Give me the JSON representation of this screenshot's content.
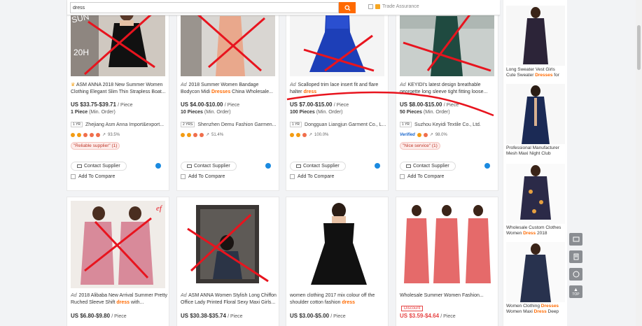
{
  "search": {
    "value": "dress",
    "button_icon": "search-icon",
    "trade_assurance": "Trade Assurance"
  },
  "products_row1": [
    {
      "ad": "",
      "crown": true,
      "title_pre": "ASM ANNA 2018 New Summer Women Clothing Elegant Slim Thin Strapless Boat...",
      "title_kw": "",
      "title_post": "",
      "price": "US $33.75-$39.71",
      "unit": "/ Piece",
      "moq_qty": "1 Piece",
      "moq_label": "(Min. Order)",
      "yrs": "1 YR",
      "supplier": "Zhejiang Asm Anna Import&export...",
      "rate": "93.5%",
      "tag": "\"Reliable supplier\" (1)",
      "contact": "Contact Supplier",
      "compare": "Add To Compare"
    },
    {
      "ad": "Ad",
      "crown": false,
      "title_pre": "2018 Summer Women Bandage Bodycon Midi ",
      "title_kw": "Dresses",
      "title_post": " China Wholesale...",
      "price": "US $4.00-$10.00",
      "unit": "/ Piece",
      "moq_qty": "10 Pieces",
      "moq_label": "(Min. Order)",
      "yrs": "2 YRS",
      "supplier": "Shenzhen Demu Fashion Garmen...",
      "rate": "51.4%",
      "tag": "",
      "contact": "Contact Supplier",
      "compare": "Add To Compare"
    },
    {
      "ad": "Ad",
      "crown": false,
      "title_pre": "Scalloped trim lace insert fit and flare halter ",
      "title_kw": "dress",
      "title_post": "",
      "price": "US $7.00-$15.00",
      "unit": "/ Piece",
      "moq_qty": "100 Pieces",
      "moq_label": "(Min. Order)",
      "yrs": "1 YR",
      "supplier": "Dongguan Liangjun Garment Co., L...",
      "rate": "100.0%",
      "tag": "",
      "contact": "Contact Supplier",
      "compare": "Add To Compare"
    },
    {
      "ad": "Ad",
      "crown": false,
      "title_pre": "KEYIDI's latest design breathable georgette long sleeve tight fitting loose...",
      "title_kw": "",
      "title_post": "",
      "price": "US $8.00-$15.00",
      "unit": "/ Piece",
      "moq_qty": "50 Pieces",
      "moq_label": "(Min. Order)",
      "yrs": "1 YR",
      "supplier": "Suzhou Keyidi Textile Co., Ltd.",
      "rate": "98.0%",
      "verified": "Verified",
      "tag": "\"Nice service\" (1)",
      "contact": "Contact Supplier",
      "compare": "Add To Compare"
    }
  ],
  "products_row2": [
    {
      "ad": "Ad",
      "title_pre": "2018 Alibaba New Arrival Summer Pretty Ruched Sleeve Shift ",
      "title_kw": "dress",
      "title_post": " with...",
      "price": "US $6.80-$9.80",
      "unit": "/ Piece",
      "red": false,
      "discount": ""
    },
    {
      "ad": "Ad",
      "title_pre": "ASM ANNA Women Stylish Long Chiffon Office Lady Printed Floral Sexy Maxi Girls...",
      "title_kw": "",
      "title_post": "",
      "price": "US $30.38-$35.74",
      "unit": "/ Piece",
      "red": false,
      "discount": ""
    },
    {
      "ad": "",
      "title_pre": "women clothing 2017 mix colour off the shoulder cotton fashion ",
      "title_kw": "dress",
      "title_post": "",
      "price": "US $3.00-$5.00",
      "unit": "/ Piece",
      "red": false,
      "discount": ""
    },
    {
      "ad": "",
      "title_pre": "Wholesale Summer Women Fashion...",
      "title_kw": "",
      "title_post": "",
      "price": "US $3.59-$4.64",
      "unit": "/ Piece",
      "red": true,
      "discount": "Discount"
    }
  ],
  "sidebar": [
    {
      "pre": "Long Sweater Vest Girls Cute Sweater ",
      "kw": "Dresses",
      "post": " for"
    },
    {
      "pre": "Professional Manufacturer Mesh Maxi Night Club",
      "kw": "",
      "post": ""
    },
    {
      "pre": "Wholesale Custom Clothes Women ",
      "kw": "Dress",
      "post": " 2018"
    },
    {
      "pre": "Women Clothing ",
      "kw": "Dresses",
      "post": "",
      "pre2": " Women Maxi ",
      "kw2": "Dress",
      "post2": " Deep"
    }
  ],
  "tools": {
    "top_label": "TOP"
  },
  "colors": {
    "accent": "#ff6a00",
    "annotation": "#e8141e",
    "price_red": "#e64545"
  }
}
